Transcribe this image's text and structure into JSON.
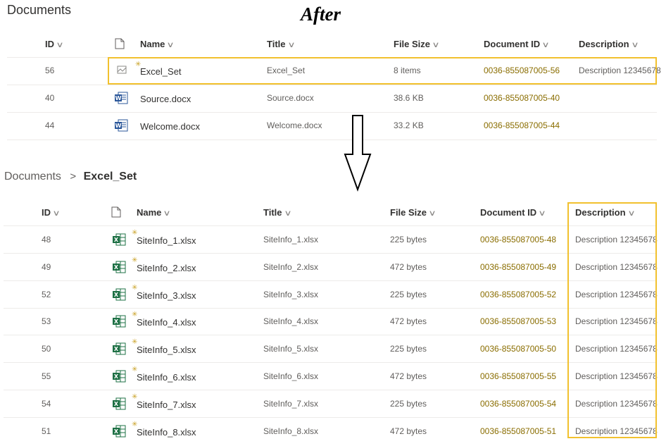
{
  "top": {
    "title": "Documents",
    "annotation": "After",
    "headers": {
      "id": "ID",
      "name": "Name",
      "title": "Title",
      "size": "File Size",
      "docid": "Document ID",
      "desc": "Description"
    },
    "rows": [
      {
        "id": "56",
        "name": "Excel_Set",
        "title": "Excel_Set",
        "size": "8 items",
        "docid": "0036-855087005-56",
        "desc": "Description 12345678",
        "icon": "docset-icon"
      },
      {
        "id": "40",
        "name": "Source.docx",
        "title": "Source.docx",
        "size": "38.6 KB",
        "docid": "0036-855087005-40",
        "desc": "",
        "icon": "word-icon"
      },
      {
        "id": "44",
        "name": "Welcome.docx",
        "title": "Welcome.docx",
        "size": "33.2 KB",
        "docid": "0036-855087005-44",
        "desc": "",
        "icon": "word-icon"
      }
    ]
  },
  "bottom": {
    "breadcrumb": {
      "root": "Documents",
      "separator": ">",
      "current": "Excel_Set"
    },
    "headers": {
      "id": "ID",
      "name": "Name",
      "title": "Title",
      "size": "File Size",
      "docid": "Document ID",
      "desc": "Description"
    },
    "rows": [
      {
        "id": "48",
        "name": "SiteInfo_1.xlsx",
        "title": "SiteInfo_1.xlsx",
        "size": "225 bytes",
        "docid": "0036-855087005-48",
        "desc": "Description 12345678"
      },
      {
        "id": "49",
        "name": "SiteInfo_2.xlsx",
        "title": "SiteInfo_2.xlsx",
        "size": "472 bytes",
        "docid": "0036-855087005-49",
        "desc": "Description 12345678"
      },
      {
        "id": "52",
        "name": "SiteInfo_3.xlsx",
        "title": "SiteInfo_3.xlsx",
        "size": "225 bytes",
        "docid": "0036-855087005-52",
        "desc": "Description 12345678"
      },
      {
        "id": "53",
        "name": "SiteInfo_4.xlsx",
        "title": "SiteInfo_4.xlsx",
        "size": "472 bytes",
        "docid": "0036-855087005-53",
        "desc": "Description 12345678"
      },
      {
        "id": "50",
        "name": "SiteInfo_5.xlsx",
        "title": "SiteInfo_5.xlsx",
        "size": "225 bytes",
        "docid": "0036-855087005-50",
        "desc": "Description 12345678"
      },
      {
        "id": "55",
        "name": "SiteInfo_6.xlsx",
        "title": "SiteInfo_6.xlsx",
        "size": "472 bytes",
        "docid": "0036-855087005-55",
        "desc": "Description 12345678"
      },
      {
        "id": "54",
        "name": "SiteInfo_7.xlsx",
        "title": "SiteInfo_7.xlsx",
        "size": "225 bytes",
        "docid": "0036-855087005-54",
        "desc": "Description 12345678"
      },
      {
        "id": "51",
        "name": "SiteInfo_8.xlsx",
        "title": "SiteInfo_8.xlsx",
        "size": "472 bytes",
        "docid": "0036-855087005-51",
        "desc": "Description 12345678"
      }
    ]
  },
  "colors": {
    "highlight": "#f2c12e",
    "docid": "#8a6d00",
    "excel": "#1d7044",
    "word": "#2b579a"
  }
}
